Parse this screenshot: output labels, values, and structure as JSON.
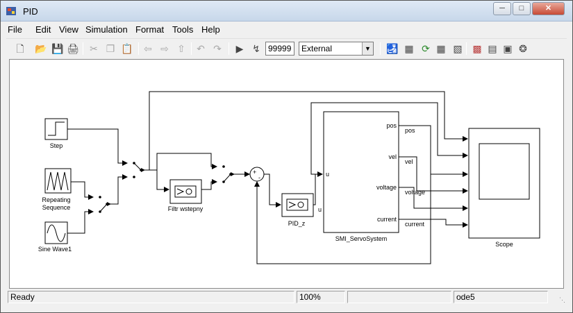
{
  "window": {
    "title": "PID"
  },
  "menubar": {
    "items": [
      "File",
      "Edit",
      "View",
      "Simulation",
      "Format",
      "Tools",
      "Help"
    ]
  },
  "toolbar": {
    "stop_time": "99999",
    "sim_mode": "External"
  },
  "blocks": {
    "step": "Step",
    "repeating_sequence_1": "Repeating",
    "repeating_sequence_2": "Sequence",
    "sine_wave": "Sine Wave1",
    "filter": "Filtr wstepny",
    "pid": "PID_z",
    "pid_port_out": "u",
    "servo": "SMI_ServoSystem",
    "servo_in_u": "u",
    "servo_out_pos": "pos",
    "servo_out_vel": "vel",
    "servo_out_voltage": "voltage",
    "servo_out_current": "current",
    "sig_pos": "pos",
    "sig_vel": "vel",
    "sig_voltage": "voltage",
    "sig_current": "current",
    "scope": "Scope",
    "sum_plus": "+",
    "sum_minus": "-"
  },
  "statusbar": {
    "status": "Ready",
    "zoom": "100%",
    "solver": "ode5"
  }
}
